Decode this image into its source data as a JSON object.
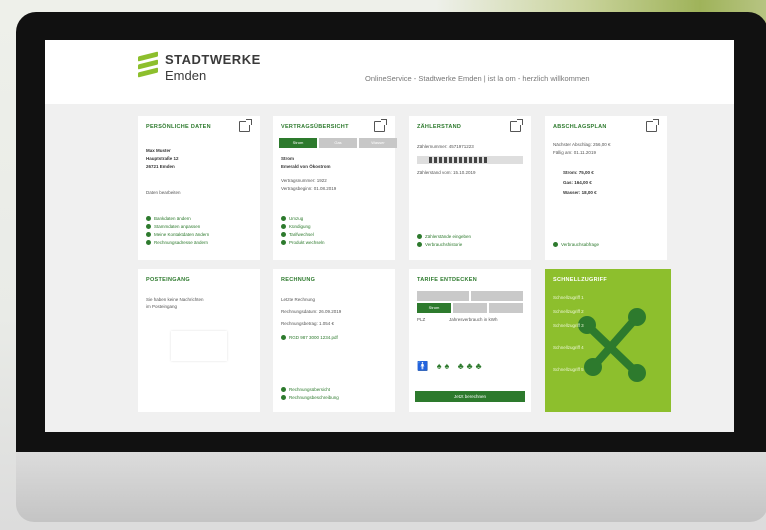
{
  "header": {
    "brand_line1": "STADTWERKE",
    "brand_line2": "Emden",
    "tagline": "OnlineService - Stadtwerke Emden | ist la om - herzlich willkommen"
  },
  "personal": {
    "title": "PERSÖNLICHE DATEN",
    "name": "Max Muster",
    "street": "Hauptstraße 12",
    "city": "26721 Emden",
    "edit": "Daten bearbeiten",
    "links": [
      "Bankdaten ändern",
      "Stammdaten anpassen",
      "Meine Kontaktdaten ändern",
      "Rechnungsadresse ändern"
    ]
  },
  "contracts": {
    "title": "VERTRAGSÜBERSICHT",
    "tabs": [
      "Strom",
      "Gas",
      "Wasser"
    ],
    "product": "Strom",
    "product_name": "Emerald von Ökostrom",
    "contract_no": "Vertragsnummer: 1922",
    "contract_start": "Vertragsbeginn: 01.08.2019",
    "links": [
      "Umzug",
      "Kündigung",
      "Tarifwechsel",
      "Produkt wechseln"
    ]
  },
  "meter": {
    "title": "ZÄHLERSTAND",
    "meter_no": "Zählernummer: 4571971223",
    "reading_label": "Zählerstand vom: 15.10.2019",
    "links": [
      "Zählerstände eingeben",
      "Verbrauchshistorie"
    ]
  },
  "discount": {
    "title": "ABSCHLAGSPLAN",
    "line1": "Nächster Abschlag: 256,00 €",
    "line2": "Fällig am: 01.11.2019",
    "strom": "Strom: 75,00 €",
    "gas": "Gas: 164,00 €",
    "wasser": "Wasser: 18,00 €",
    "link": "Verbrauchsabfrage"
  },
  "mailbox": {
    "title": "POSTEINGANG",
    "text1": "Sie haben keine Nachrichten",
    "text2": "im Posteingang"
  },
  "invoice": {
    "title": "RECHNUNG",
    "last": "Letzte Rechnung",
    "date": "Rechnungsdatum: 26.09.2019",
    "amount": "Rechnungsbetrag: 1.054 €",
    "file": "RGD 987 3000 1234.pdf",
    "links": [
      "Rechnungsübersicht",
      "Rechnungsbeschreibung"
    ]
  },
  "tariff": {
    "title": "TARIFE ENTDECKEN",
    "active_tab": "Strom",
    "plz": "PLZ",
    "consumption": "Jahresverbrauch in kWh",
    "button": "Jetzt berechnen"
  },
  "quicklinks": {
    "title": "SCHNELLZUGRIFF",
    "items": [
      "Schnellzugriff 1",
      "Schnellzugriff 2",
      "Schnellzugriff 3",
      "Schnellzugriff 4",
      "Schnellzugriff 5"
    ]
  },
  "colors": {
    "brand_green": "#2d7a2d",
    "accent_green": "#8dbf2d"
  }
}
